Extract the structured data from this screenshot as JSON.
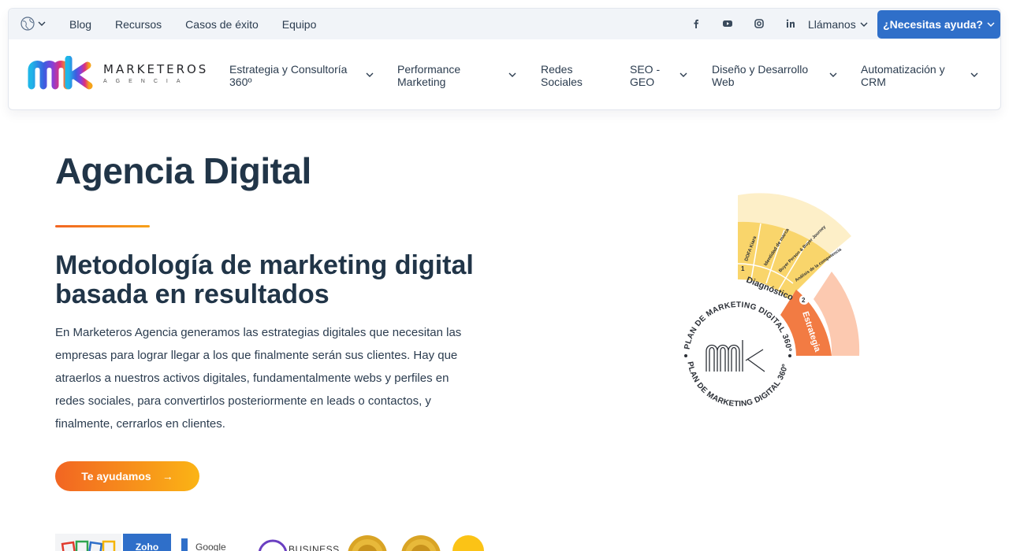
{
  "topbar": {
    "language_icon": "globe-icon",
    "links": [
      "Blog",
      "Recursos",
      "Casos de éxito",
      "Equipo"
    ],
    "socials": [
      "facebook-icon",
      "youtube-icon",
      "instagram-icon",
      "linkedin-icon"
    ],
    "call_label": "Llámanos",
    "help_label": "¿Necesitas ayuda?"
  },
  "brand": {
    "name": "MARKETEROS",
    "sub": "AGENCIA"
  },
  "nav": [
    {
      "label": "Estrategia y Consultoría 360º"
    },
    {
      "label": "Performance Marketing"
    },
    {
      "label": "Redes Sociales"
    },
    {
      "label": "SEO - GEO"
    },
    {
      "label": "Diseño y Desarrollo Web"
    },
    {
      "label": "Automatización y CRM"
    }
  ],
  "hero": {
    "title": "Agencia Digital",
    "subtitle": "Metodología de marketing digital basada en resultados",
    "body": "En Marketeros Agencia generamos las estrategias digitales que necesitan las empresas para lograr llegar a los que finalmente serán sus clientes. Hay que atraerlos a nuestros activos digitales, fundamentalmente webs y perfiles en redes sociales, para convertirlos posteriormente en leads o contactos, y finalmente, cerrarlos en clientes.",
    "cta_label": "Te ayudamos",
    "cta_arrow": "→"
  },
  "badges": {
    "zoho": "Zoho",
    "google": "Google",
    "woz": "BUSINESS"
  },
  "diagram": {
    "ring_text": "PLAN DE MARKETING DIGITAL 360º",
    "step1_num": "1",
    "step1_label": "Diagnóstico",
    "step2_num": "2",
    "step2_label": "Estrategia",
    "diag_items": [
      "DOFA Kiara",
      "Identidad de marca",
      "Buyer Person & Buyer Journey",
      "Análisis de la competencia"
    ],
    "colors": {
      "yellow": "#f9d56b",
      "light_yellow": "#fdefc8",
      "orange": "#f27b43",
      "light_orange": "#fcc9b0",
      "ring": "#2b2f36"
    }
  }
}
